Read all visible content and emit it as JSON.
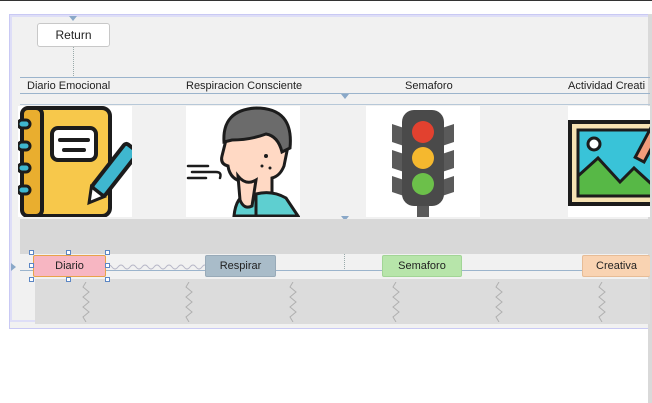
{
  "toolbar": {
    "return_label": "Return"
  },
  "activities": [
    {
      "label": "Diario Emocional",
      "chip": "Diario",
      "chip_color": "#f7b6c2",
      "icon": "notebook-pen-icon"
    },
    {
      "label": "Respiracion Consciente",
      "chip": "Respirar",
      "chip_color": "#a9bcc9",
      "icon": "breathing-person-icon"
    },
    {
      "label": "Semaforo",
      "chip": "Semaforo",
      "chip_color": "#b7e5aa",
      "icon": "traffic-light-icon"
    },
    {
      "label": "Actividad Creati",
      "chip": "Creativa",
      "chip_color": "#f9d3b2",
      "icon": "landscape-picture-pencil-icon"
    }
  ]
}
